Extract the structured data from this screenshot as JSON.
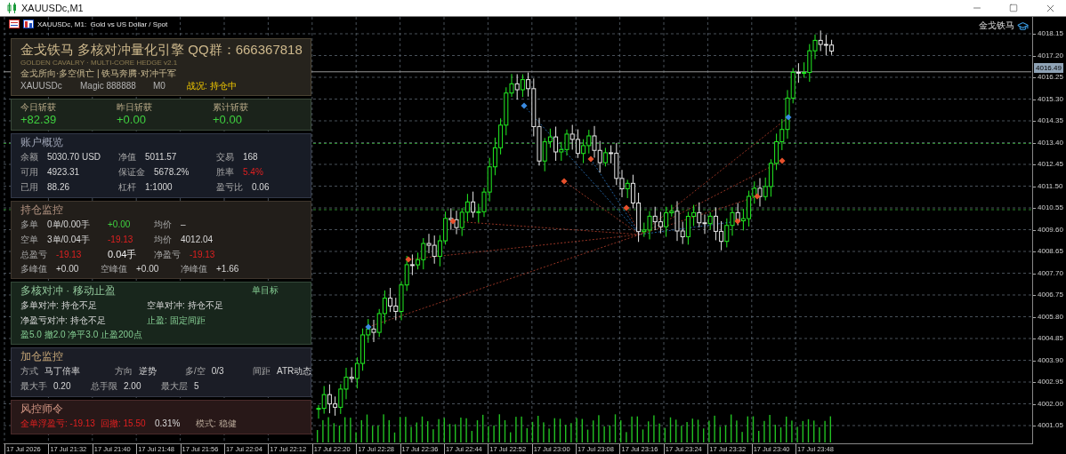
{
  "window": {
    "title": "XAUUSDc,M1"
  },
  "chart": {
    "header": "XAUUSDc, M1:  Gold vs US Dollar / Spot",
    "corner_label": "金戈铁马",
    "current_price": "4016.49",
    "price_axis": [
      "4018.15",
      "4017.20",
      "4016.25",
      "4015.30",
      "4014.35",
      "4013.40",
      "4012.45",
      "4011.50",
      "4010.55",
      "4009.60",
      "4008.65",
      "4007.70",
      "4006.75",
      "4005.80",
      "4004.85",
      "4003.90",
      "4002.95",
      "4002.00",
      "4001.05"
    ],
    "time_axis": [
      "17 Jul 2026",
      "17 Jul 21:32",
      "17 Jul 21:40",
      "17 Jul 21:48",
      "17 Jul 21:56",
      "17 Jul 22:04",
      "17 Jul 22:12",
      "17 Jul 22:20",
      "17 Jul 22:28",
      "17 Jul 22:36",
      "17 Jul 22:44",
      "17 Jul 22:52",
      "17 Jul 23:00",
      "17 Jul 23:08",
      "17 Jul 23:16",
      "17 Jul 23:24",
      "17 Jul 23:32",
      "17 Jul 23:40",
      "17 Jul 23:48"
    ]
  },
  "panel": {
    "header": {
      "title": "金戈铁马 多核对冲量化引擎 QQ群：666367818",
      "subtitle": "GOLDEN CAVALRY · MULTI-CORE HEDGE v2.1",
      "motto": "金戈所向·多空俱亡 | 铁马奔腾·对冲千军",
      "symbol": "XAUUSDc",
      "magic": "Magic 888888",
      "mode": "M0",
      "status": "战况: 持仓中"
    },
    "gains": [
      {
        "label": "今日斩获",
        "value": "+82.39"
      },
      {
        "label": "昨日斩获",
        "value": "+0.00"
      },
      {
        "label": "累计斩获",
        "value": "+0.00"
      }
    ],
    "sections": [
      {
        "kind": "account",
        "title": "账户概览",
        "rows": [
          {
            "kind": "main",
            "items": [
              {
                "label": "余额",
                "value": "5030.70 USD",
                "kind": "plain"
              },
              {
                "label": "净值",
                "value": "5011.57",
                "kind": "plain"
              },
              {
                "label": "交易",
                "value": "168",
                "kind": "plain"
              }
            ]
          },
          {
            "kind": "main",
            "items": [
              {
                "label": "可用",
                "value": "4923.31",
                "kind": "plain"
              },
              {
                "label": "保证金",
                "value": "5678.2%",
                "kind": "plain"
              },
              {
                "label": "胜率",
                "value": "5.4%",
                "kind": "negative"
              }
            ]
          },
          {
            "kind": "main",
            "items": [
              {
                "label": "已用",
                "value": "88.26",
                "kind": "plain"
              },
              {
                "label": "杠杆",
                "value": "1:1000",
                "kind": "plain"
              },
              {
                "label": "盈亏比",
                "value": "0.06",
                "kind": "plain"
              }
            ]
          }
        ]
      },
      {
        "kind": "position",
        "title": "持仓监控",
        "rows": [
          {
            "kind": "main",
            "items": [
              {
                "label": "多单",
                "value": "0单/0.00手",
                "kind": "plain"
              },
              {
                "value": "+0.00",
                "kind": "positive"
              },
              {
                "label": "均价",
                "value": "–",
                "kind": "plain"
              }
            ]
          },
          {
            "kind": "main",
            "items": [
              {
                "label": "空单",
                "value": "3单/0.04手",
                "kind": "plain"
              },
              {
                "value": "-19.13",
                "kind": "negative"
              },
              {
                "label": "均价",
                "value": "4012.04",
                "kind": "plain"
              }
            ]
          },
          {
            "kind": "main",
            "items": [
              {
                "label": "总盈亏",
                "value": "-19.13",
                "kind": "negative"
              },
              {
                "value": "0.04手",
                "kind": "strong"
              },
              {
                "label": "净盈亏",
                "value": "-19.13",
                "kind": "negative"
              }
            ]
          },
          {
            "kind": "detail",
            "items": [
              {
                "label": "多峰值",
                "value": "+0.00",
                "kind": "plain"
              },
              {
                "label": "空峰值",
                "value": "+0.00",
                "kind": "plain"
              },
              {
                "label": "净峰值",
                "value": "+1.66",
                "kind": "plain"
              }
            ]
          }
        ]
      },
      {
        "kind": "hedge",
        "title": "多核对冲 · 移动止盈",
        "badge": "单目标",
        "rows": [
          {
            "kind": "main",
            "items": [
              {
                "value": "多单对冲: 持仓不足",
                "kind": "plain"
              },
              {
                "value": "空单对冲: 持仓不足",
                "kind": "plain"
              }
            ]
          },
          {
            "kind": "main",
            "items": [
              {
                "value": "净盈亏对冲: 持仓不足",
                "kind": "plain"
              },
              {
                "value": "止盈: 固定间距",
                "kind": "accent"
              }
            ]
          },
          {
            "kind": "detail",
            "items": [
              {
                "value": "盈5.0 撤2.0 净平3.0 止盈200点",
                "kind": "accent"
              }
            ]
          }
        ]
      },
      {
        "kind": "pyramid",
        "title": "加仓监控",
        "rows": [
          {
            "kind": "main",
            "items": [
              {
                "label": "方式",
                "value": "马丁倍率",
                "kind": "plain"
              },
              {
                "label": "方向",
                "value": "逆势",
                "kind": "plain"
              },
              {
                "label": "多/空",
                "value": "0/3",
                "kind": "plain"
              },
              {
                "label": "间距",
                "value": "ATR动态",
                "kind": "plain"
              }
            ]
          },
          {
            "kind": "compact",
            "items": [
              {
                "label": "最大手",
                "value": "0.20",
                "kind": "plain"
              },
              {
                "label": "总手限",
                "value": "2.00",
                "kind": "plain"
              },
              {
                "label": "最大层",
                "value": "5",
                "kind": "plain"
              }
            ]
          }
        ]
      },
      {
        "kind": "risk",
        "title": "风控师令",
        "rows": [
          {
            "kind": "main",
            "items": [
              {
                "value": "全单浮盈亏: -19.13",
                "kind": "negative"
              },
              {
                "value": "回撤: 15.50",
                "kind": "negative"
              },
              {
                "value": "0.31%",
                "kind": "plain"
              },
              {
                "value": "模式: 稳健",
                "kind": "muted"
              }
            ]
          }
        ]
      }
    ]
  }
}
